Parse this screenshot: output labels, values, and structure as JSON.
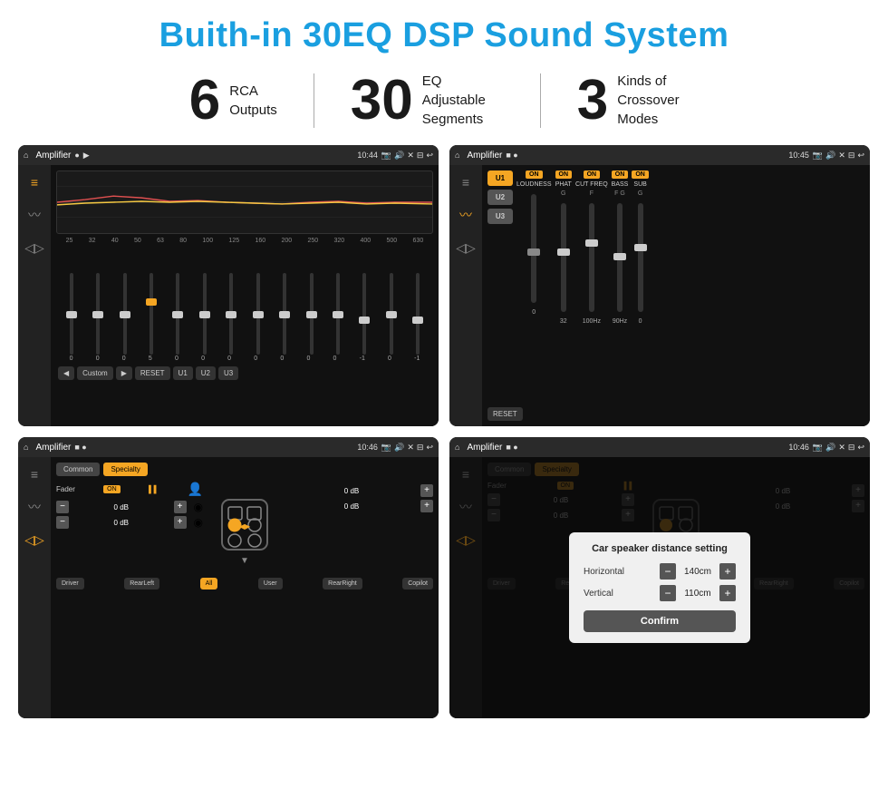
{
  "page": {
    "title": "Buith-in 30EQ DSP Sound System",
    "stats": [
      {
        "number": "6",
        "label": "RCA\nOutputs"
      },
      {
        "number": "30",
        "label": "EQ Adjustable\nSegments"
      },
      {
        "number": "3",
        "label": "Kinds of\nCrossover Modes"
      }
    ],
    "screens": [
      {
        "id": "eq-screen",
        "app": "Amplifier",
        "time": "10:44",
        "type": "equalizer"
      },
      {
        "id": "crossover-screen",
        "app": "Amplifier",
        "time": "10:45",
        "type": "crossover"
      },
      {
        "id": "fader-screen",
        "app": "Amplifier",
        "time": "10:46",
        "type": "fader"
      },
      {
        "id": "dialog-screen",
        "app": "Amplifier",
        "time": "10:46",
        "type": "dialog"
      }
    ],
    "eq": {
      "freqs": [
        "25",
        "32",
        "40",
        "50",
        "63",
        "80",
        "100",
        "125",
        "160",
        "200",
        "250",
        "320",
        "400",
        "500",
        "630"
      ],
      "values": [
        "0",
        "0",
        "0",
        "5",
        "0",
        "0",
        "0",
        "0",
        "0",
        "0",
        "0",
        "-1",
        "0",
        "-1"
      ],
      "preset": "Custom",
      "buttons": [
        "RESET",
        "U1",
        "U2",
        "U3"
      ]
    },
    "crossover": {
      "presets": [
        "U1",
        "U2",
        "U3"
      ],
      "controls": [
        {
          "label": "LOUDNESS",
          "on": true,
          "value": ""
        },
        {
          "label": "PHAT",
          "on": true,
          "value": "G"
        },
        {
          "label": "CUT FREQ",
          "on": true,
          "value": "F"
        },
        {
          "label": "BASS",
          "on": true,
          "value": "F G"
        },
        {
          "label": "SUB",
          "on": true,
          "value": "G"
        }
      ],
      "reset": "RESET"
    },
    "fader": {
      "tabs": [
        "Common",
        "Specialty"
      ],
      "fader_label": "Fader",
      "on": "ON",
      "db_values": [
        "0 dB",
        "0 dB",
        "0 dB",
        "0 dB"
      ],
      "buttons": [
        "Driver",
        "RearLeft",
        "All",
        "User",
        "RearRight",
        "Copilot"
      ]
    },
    "dialog": {
      "title": "Car speaker distance setting",
      "horizontal_label": "Horizontal",
      "horizontal_value": "140cm",
      "vertical_label": "Vertical",
      "vertical_value": "110cm",
      "confirm_label": "Confirm"
    }
  }
}
